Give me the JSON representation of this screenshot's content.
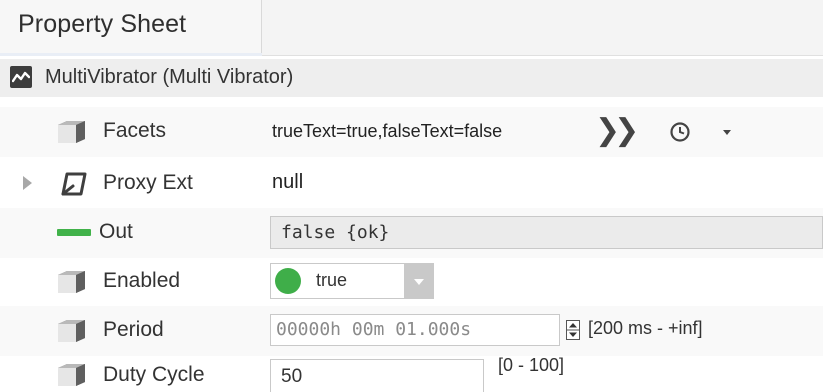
{
  "tab": {
    "label": "Property Sheet"
  },
  "component": {
    "label": "MultiVibrator  (Multi Vibrator)",
    "icon": "wave-icon"
  },
  "properties": {
    "facets": {
      "name": "Facets",
      "value": "trueText=true,falseText=false",
      "icon": "slot-cube-icon"
    },
    "proxy_ext": {
      "name": "Proxy Ext",
      "value": "null",
      "icon": "proxy-ext-icon"
    },
    "out": {
      "name": "Out",
      "value": "false {ok}",
      "status_color": "#41b24a"
    },
    "enabled": {
      "name": "Enabled",
      "value": "true",
      "status_color": "#3fae49"
    },
    "period": {
      "name": "Period",
      "value": "00000h 00m 01.000s",
      "range": "[200 ms - +inf]"
    },
    "duty_cycle": {
      "name": "Duty Cycle",
      "value": "50",
      "range": "[0 - 100]"
    }
  },
  "colors": {
    "accent_green": "#41b24a",
    "field_border": "#c9c9c9",
    "out_field_bg": "#ebebeb"
  }
}
